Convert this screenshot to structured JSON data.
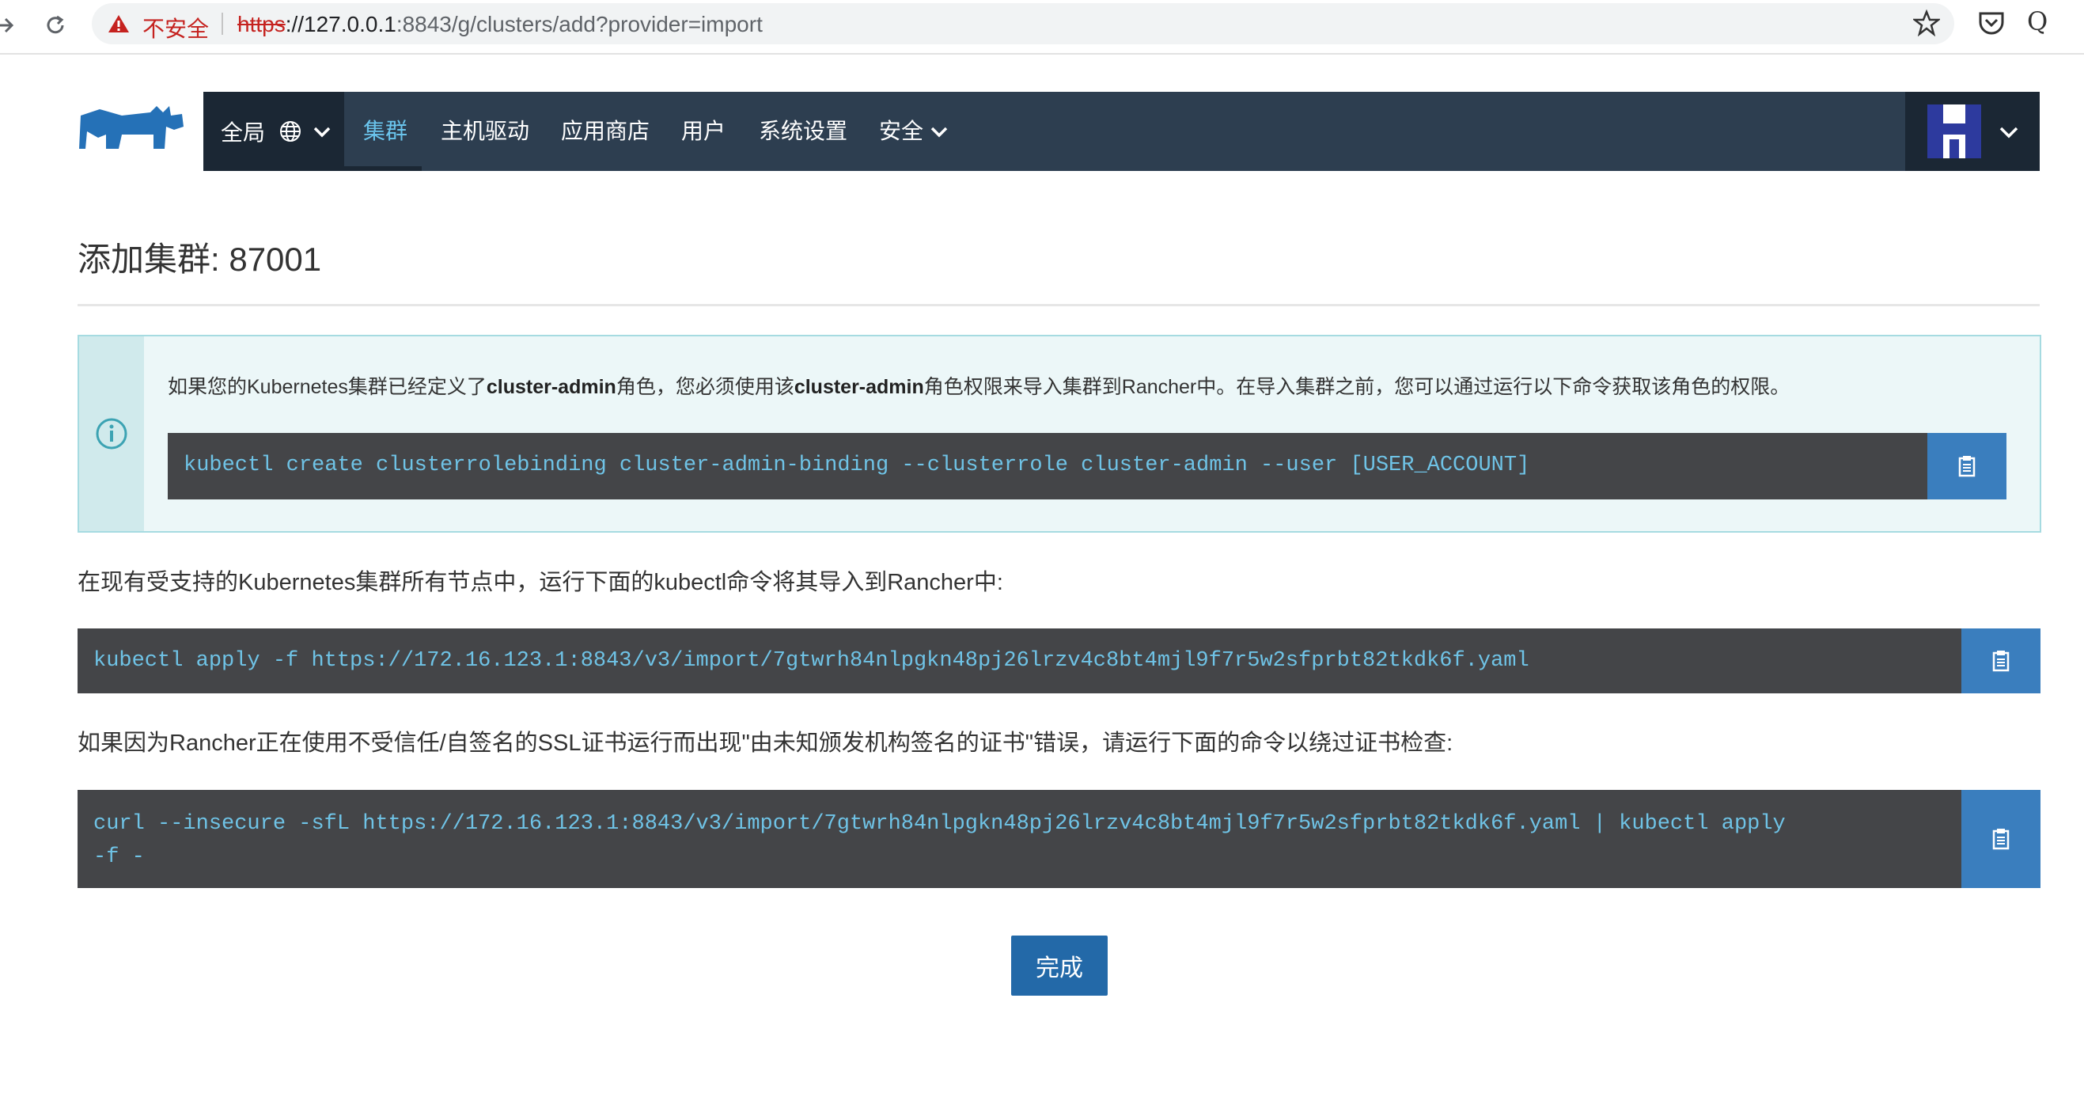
{
  "browser": {
    "insecure_label": "不安全",
    "url_scheme": "https",
    "url_host": "://127.0.0.1",
    "url_path": ":8843/g/clusters/add?provider=import",
    "extension_label": "Q"
  },
  "nav": {
    "global_label": "全局",
    "items": [
      "集群",
      "主机驱动",
      "应用商店",
      "用户",
      "系统设置",
      "安全"
    ]
  },
  "page": {
    "title": "添加集群: 87001"
  },
  "banner": {
    "text_1": "如果您的Kubernetes集群已经定义了",
    "bold_1": "cluster-admin",
    "text_2": "角色，您必须使用该",
    "bold_2": "cluster-admin",
    "text_3": "角色权限来导入集群到Rancher中。在导入集群之前，您可以通过运行以下命令获取该角色的权限。",
    "command": "kubectl create clusterrolebinding cluster-admin-binding --clusterrole cluster-admin --user [USER_ACCOUNT]"
  },
  "import": {
    "instruction": "在现有受支持的Kubernetes集群所有节点中，运行下面的kubectl命令将其导入到Rancher中:",
    "command": "kubectl apply -f https://172.16.123.1:8843/v3/import/7gtwrh84nlpgkn48pj26lrzv4c8bt4mjl9f7r5w2sfprbt82tkdk6f.yaml"
  },
  "insecure": {
    "instruction": "如果因为Rancher正在使用不受信任/自签名的SSL证书运行而出现\"由未知颁发机构签名的证书\"错误，请运行下面的命令以绕过证书检查:",
    "command": "curl --insecure -sfL https://172.16.123.1:8843/v3/import/7gtwrh84nlpgkn48pj26lrzv4c8bt4mjl9f7r5w2sfprbt82tkdk6f.yaml | kubectl apply\n-f -"
  },
  "actions": {
    "done_label": "完成"
  },
  "colors": {
    "nav_bg": "#2d3e50",
    "nav_dark": "#1b2734",
    "accent": "#3a7ebe",
    "code_bg": "#444548",
    "code_text": "#6fc3e6",
    "banner_bg": "#ecf7f8"
  }
}
